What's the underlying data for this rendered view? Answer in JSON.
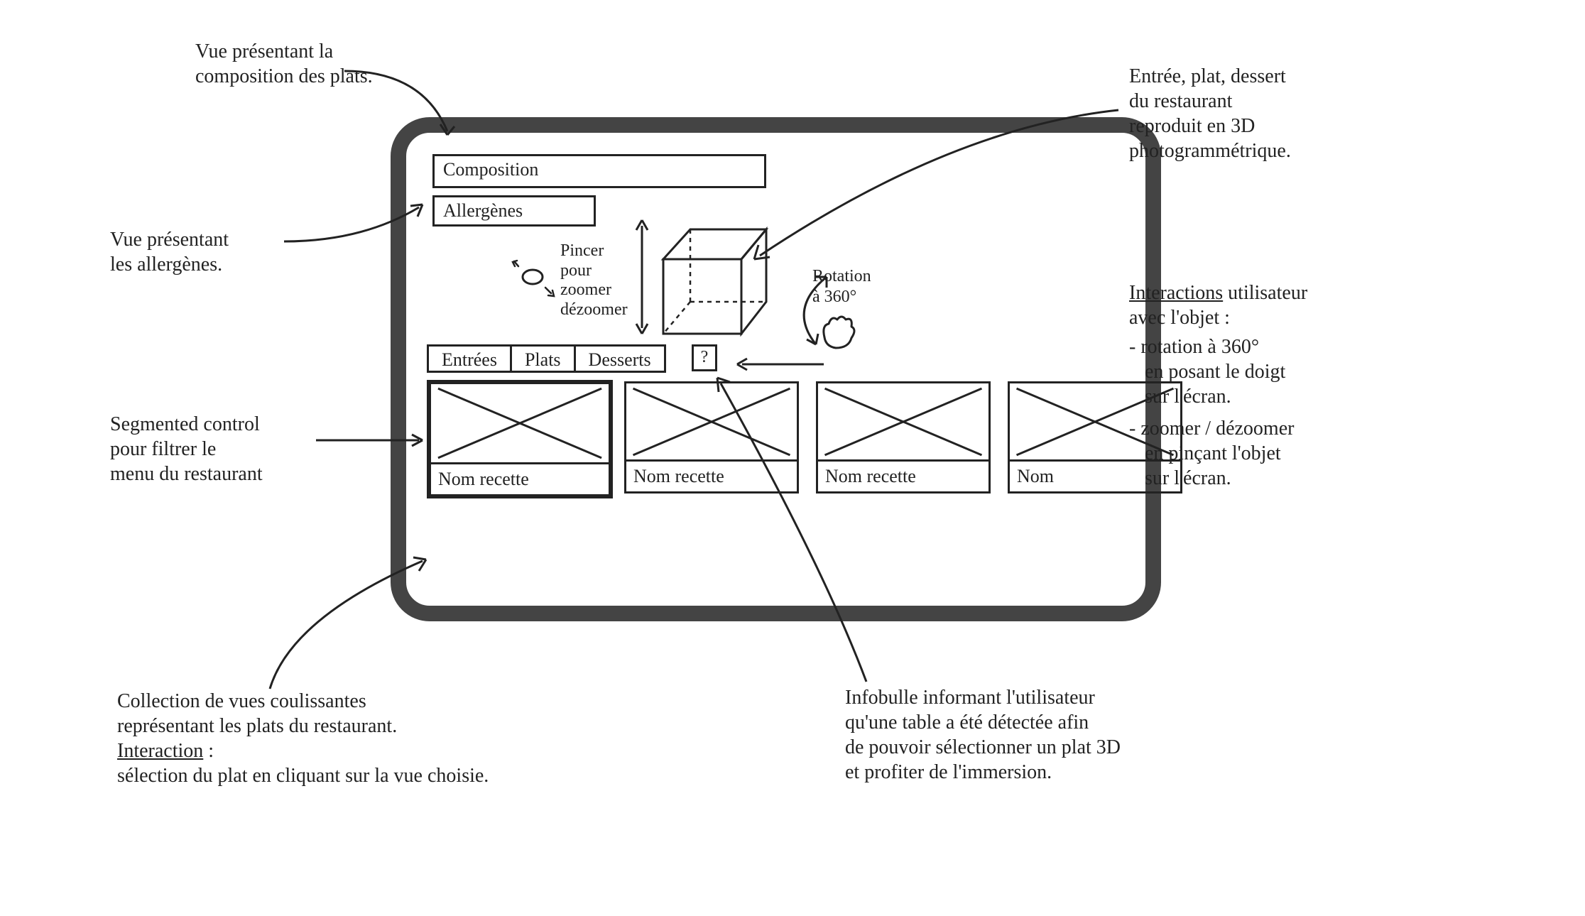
{
  "buttons": {
    "composition_label": "Composition",
    "allergenes_label": "Allergènes",
    "help_label": "?"
  },
  "segmented": {
    "entrees": "Entrées",
    "plats": "Plats",
    "desserts": "Desserts"
  },
  "hints": {
    "pinch_line1": "Pincer",
    "pinch_line2": "pour",
    "pinch_line3": "zoomer",
    "pinch_line4": "dézoomer",
    "rotation_line1": "Rotation",
    "rotation_line2": "à 360°"
  },
  "cards": {
    "caption": "Nom recette",
    "caption_short": "Nom"
  },
  "annotations": {
    "a_composition": "Vue présentant la composition des plats.",
    "a_allergenes_l1": "Vue présentant",
    "a_allergenes_l2": "les allergènes.",
    "a_segmented_l1": "Segmented control",
    "a_segmented_l2": "pour filtrer le",
    "a_segmented_l3": "menu du restaurant",
    "a_collection_l1": "Collection de vues coulissantes",
    "a_collection_l2": "représentant les plats du restaurant.",
    "a_collection_l3u": "Interaction",
    "a_collection_l3b": " :",
    "a_collection_l4": "sélection du plat en cliquant sur la vue choisie.",
    "a_infobulle_l1": "Infobulle informant l'utilisateur",
    "a_infobulle_l2": "qu'une table a été détectée afin",
    "a_infobulle_l3": "de pouvoir sélectionner un plat 3D",
    "a_infobulle_l4": "et profiter de l'immersion.",
    "a_3d_l1": "Entrée, plat, dessert",
    "a_3d_l2": "du restaurant",
    "a_3d_l3": "reproduit en 3D",
    "a_3d_l4": "photogrammétrique.",
    "a_interactions_l1u": "Interactions",
    "a_interactions_l1b": " utilisateur",
    "a_interactions_l2": "avec l'objet :",
    "a_interactions_b1a": "- rotation à 360°",
    "a_interactions_b1b": "en posant le doigt",
    "a_interactions_b1c": "sur l'écran.",
    "a_interactions_b2a": "- zoomer / dézoomer",
    "a_interactions_b2b": "en pinçant l'objet",
    "a_interactions_b2c": "sur l'écran."
  }
}
